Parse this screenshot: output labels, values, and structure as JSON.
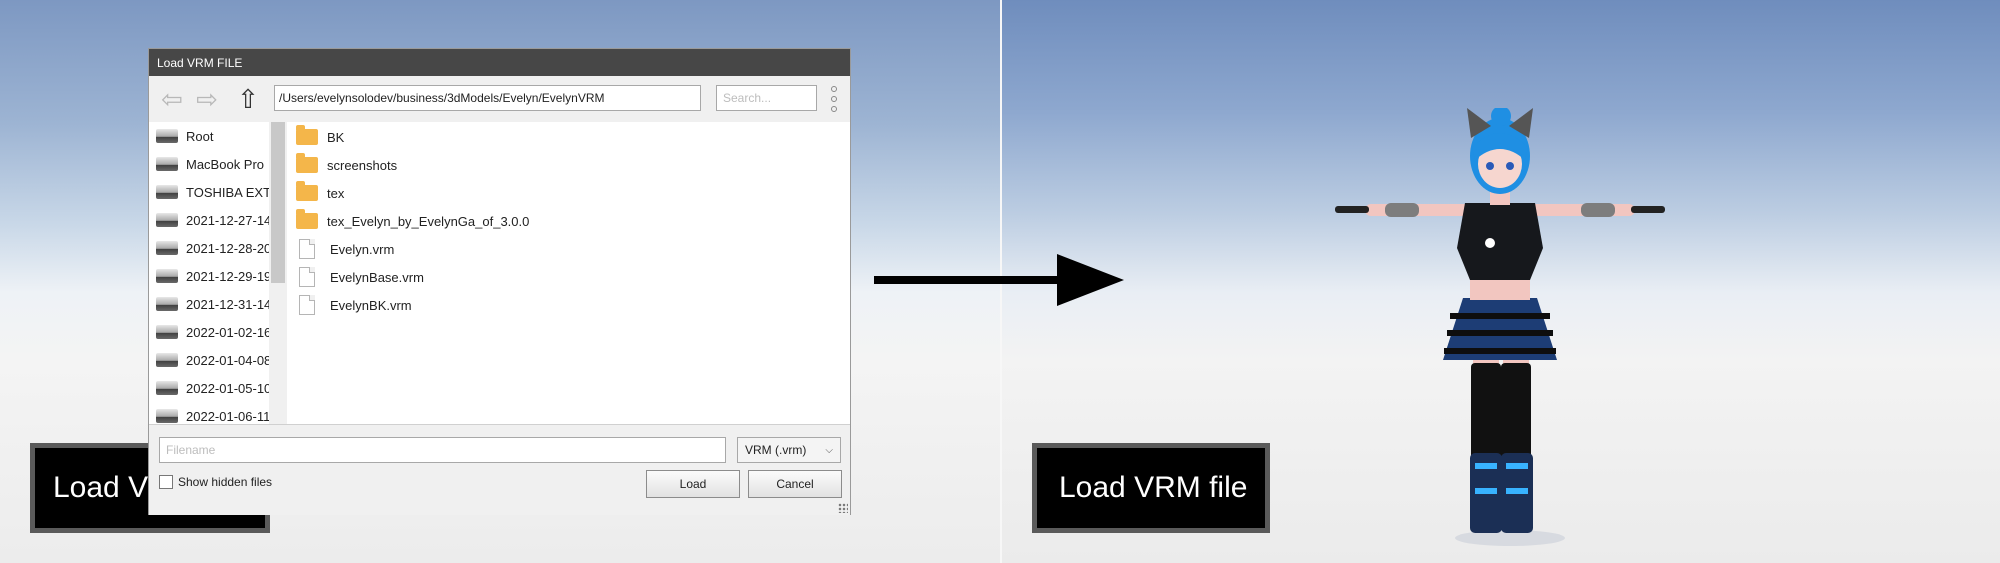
{
  "dialog": {
    "title": "Load VRM FILE",
    "path": "/Users/evelynsolodev/business/3dModels/Evelyn/EvelynVRM",
    "search_placeholder": "Search...",
    "sidebar": [
      {
        "label": "Root",
        "icon": "drive-icon"
      },
      {
        "label": "MacBook Pro",
        "icon": "drive-icon"
      },
      {
        "label": "TOSHIBA EXT",
        "icon": "drive-icon"
      },
      {
        "label": "2021-12-27-14",
        "icon": "drive-icon"
      },
      {
        "label": "2021-12-28-20",
        "icon": "drive-icon"
      },
      {
        "label": "2021-12-29-19",
        "icon": "drive-icon"
      },
      {
        "label": "2021-12-31-14",
        "icon": "drive-icon"
      },
      {
        "label": "2022-01-02-16",
        "icon": "drive-icon"
      },
      {
        "label": "2022-01-04-08",
        "icon": "drive-icon"
      },
      {
        "label": "2022-01-05-10",
        "icon": "drive-icon"
      },
      {
        "label": "2022-01-06-11",
        "icon": "drive-icon"
      }
    ],
    "files": [
      {
        "name": "BK",
        "type": "folder"
      },
      {
        "name": "screenshots",
        "type": "folder"
      },
      {
        "name": "tex",
        "type": "folder"
      },
      {
        "name": "tex_Evelyn_by_EvelynGa_of_3.0.0",
        "type": "folder"
      },
      {
        "name": "Evelyn.vrm",
        "type": "file"
      },
      {
        "name": "EvelynBase.vrm",
        "type": "file"
      },
      {
        "name": "EvelynBK.vrm",
        "type": "file"
      }
    ],
    "filename_placeholder": "Filename",
    "filetype": "VRM (.vrm)",
    "show_hidden_label": "Show hidden files",
    "show_hidden_checked": false,
    "load_label": "Load",
    "cancel_label": "Cancel"
  },
  "left_button_label": "Load VRM file",
  "right_button_label": "Load VRM file"
}
